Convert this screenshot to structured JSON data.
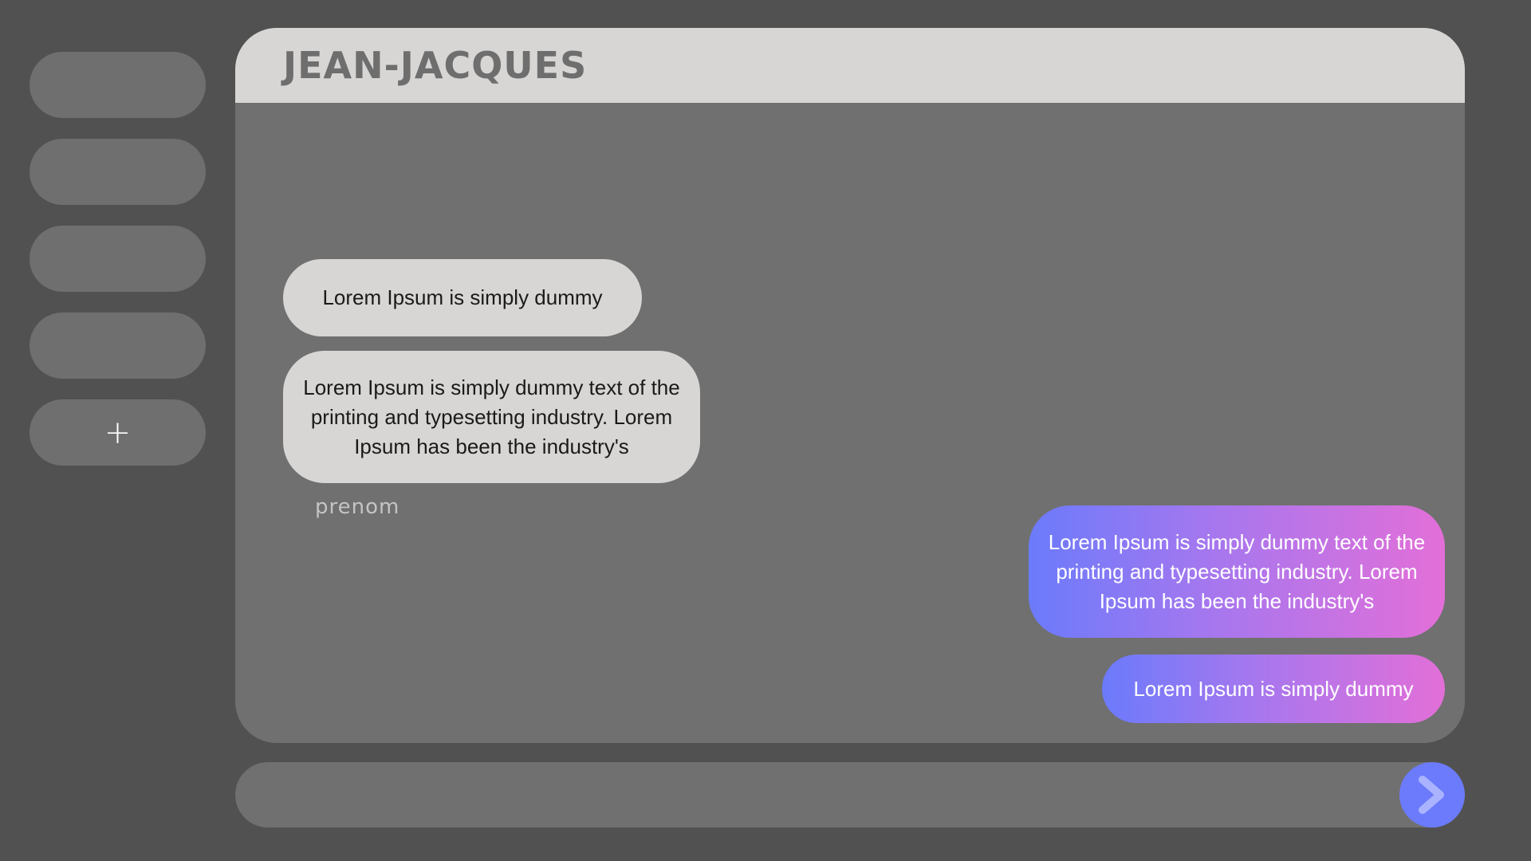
{
  "sidebar": {
    "items": [
      {
        "label": ""
      },
      {
        "label": ""
      },
      {
        "label": ""
      },
      {
        "label": ""
      }
    ],
    "add_label": "+"
  },
  "chat": {
    "contact_name": "JEAN-JACQUES",
    "messages": [
      {
        "direction": "received",
        "text": "Lorem Ipsum is simply dummy"
      },
      {
        "direction": "received",
        "text": "Lorem Ipsum is simply dummy text of the printing and typesetting industry. Lorem Ipsum has been the industry's"
      },
      {
        "direction": "sent",
        "text": "Lorem Ipsum is simply dummy text of the printing and typesetting industry. Lorem Ipsum has been the industry's"
      },
      {
        "direction": "sent",
        "text": "Lorem Ipsum is simply dummy"
      }
    ],
    "sender_label": "prenom"
  },
  "composer": {
    "value": "",
    "placeholder": "",
    "send_icon": "chevron-right-icon"
  },
  "colors": {
    "background": "#515151",
    "panel": "#707070",
    "header": "#d7d6d4",
    "received_bubble": "#d7d6d4",
    "sent_gradient_start": "#6b7bfb",
    "sent_gradient_end": "#e36fd8",
    "send_button": "#6b7bfb",
    "send_icon": "#a9b3ff"
  }
}
